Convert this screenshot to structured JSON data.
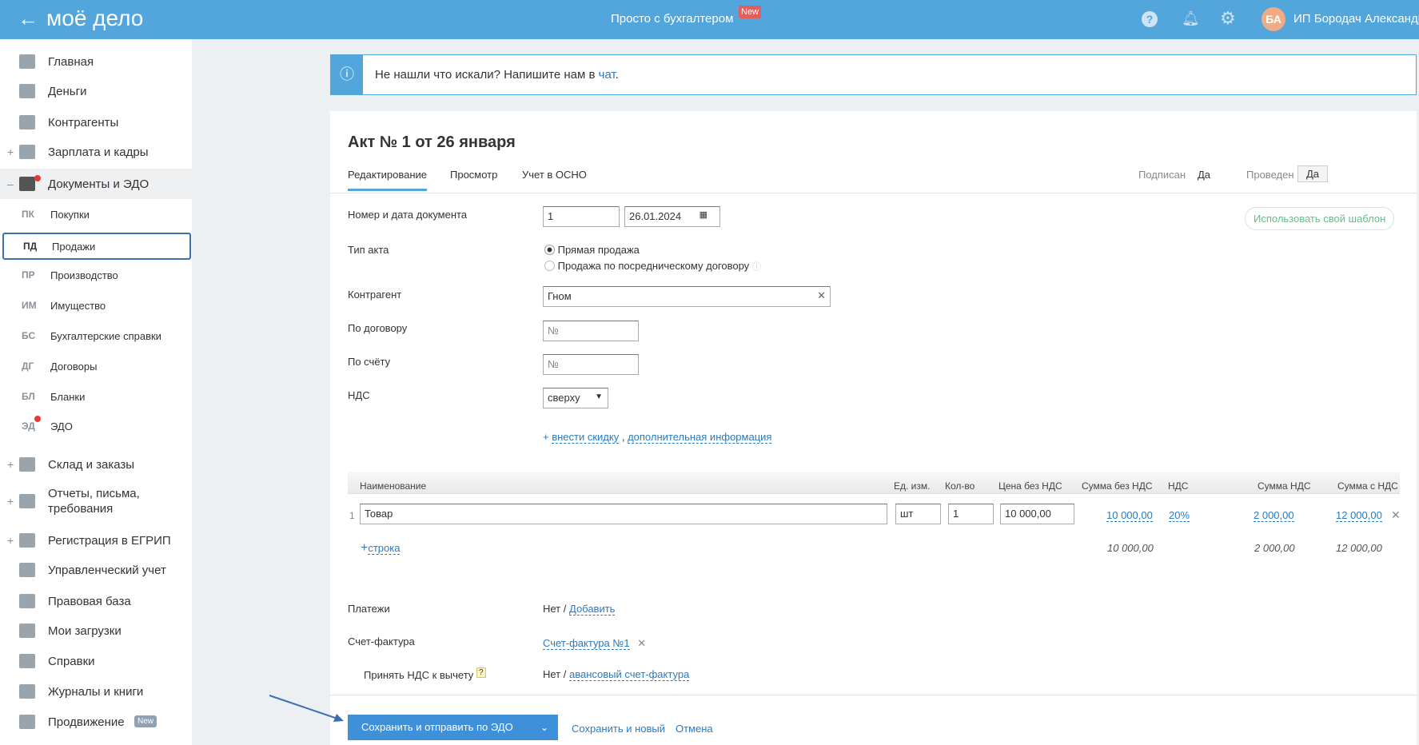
{
  "header": {
    "logo": "моё дело",
    "center": "Просто с бухгалтером",
    "new_badge": "New",
    "avatar": "БА",
    "user": "ИП Бородач Александр"
  },
  "sidebar": {
    "items": [
      {
        "label": "Главная"
      },
      {
        "label": "Деньги"
      },
      {
        "label": "Контрагенты"
      },
      {
        "label": "Зарплата и кадры"
      },
      {
        "label": "Документы и ЭДО"
      },
      {
        "abbr": "ПК",
        "label": "Покупки"
      },
      {
        "abbr": "ПД",
        "label": "Продажи"
      },
      {
        "abbr": "ПР",
        "label": "Производство"
      },
      {
        "abbr": "ИМ",
        "label": "Имущество"
      },
      {
        "abbr": "БС",
        "label": "Бухгалтерские справки"
      },
      {
        "abbr": "ДГ",
        "label": "Договоры"
      },
      {
        "abbr": "БЛ",
        "label": "Бланки"
      },
      {
        "abbr": "ЭД",
        "label": "ЭДО"
      },
      {
        "label": "Склад и заказы"
      },
      {
        "label": "Отчеты, письма, требования"
      },
      {
        "label": "Регистрация в ЕГРИП"
      },
      {
        "label": "Управленческий учет"
      },
      {
        "label": "Правовая база"
      },
      {
        "label": "Мои загрузки"
      },
      {
        "label": "Справки"
      },
      {
        "label": "Журналы и книги"
      },
      {
        "label": "Продвижение",
        "badge": "New"
      }
    ]
  },
  "info": {
    "text": "Не нашли что искали? Напишите нам в ",
    "link": "чат",
    "end": "."
  },
  "doc": {
    "title": "Акт № 1 от 26 января",
    "tabs": [
      "Редактирование",
      "Просмотр",
      "Учет в ОСНО"
    ],
    "signed_label": "Подписан",
    "signed_value": "Да",
    "posted_label": "Проведен",
    "posted_value": "Да",
    "template_button": "Использовать свой шаблон",
    "form": {
      "number_label": "Номер и дата документа",
      "number": "1",
      "date": "26.01.2024",
      "type_label": "Тип акта",
      "type_options": [
        "Прямая продажа",
        "Продажа по посредническому договору"
      ],
      "contractor_label": "Контрагент",
      "contractor": "Гном",
      "contract_label": "По договору",
      "contract_placeholder": "№",
      "invoice_label": "По счёту",
      "invoice_placeholder": "№",
      "vat_label": "НДС",
      "vat": "сверху",
      "discount_link": "внести скидку",
      "extra_link": "дополнительная информация"
    },
    "table": {
      "headers": [
        "Наименование",
        "Ед. изм.",
        "Кол-во",
        "Цена без НДС",
        "Сумма без НДС",
        "НДС",
        "Сумма НДС",
        "Сумма с НДС"
      ],
      "rows": [
        {
          "n": "1",
          "name": "Товар",
          "unit": "шт",
          "qty": "1",
          "price": "10 000,00",
          "sum": "10 000,00",
          "vat": "20%",
          "vat_sum": "2 000,00",
          "total": "12 000,00"
        }
      ],
      "add_row": "строка",
      "totals": {
        "sum": "10 000,00",
        "vat_sum": "2 000,00",
        "total": "12 000,00"
      }
    },
    "payments_label": "Платежи",
    "payments_value": "Нет /",
    "payments_link": "Добавить",
    "sf_label": "Счет-фактура",
    "sf_link": "Счет-фактура №1",
    "accept_label": "Принять НДС к вычету",
    "accept_value": "Нет /",
    "accept_link": "авансовый счет-фактура"
  },
  "footer": {
    "save_edo": "Сохранить и отправить по ЭДО",
    "save_new": "Сохранить и новый",
    "cancel": "Отмена"
  }
}
